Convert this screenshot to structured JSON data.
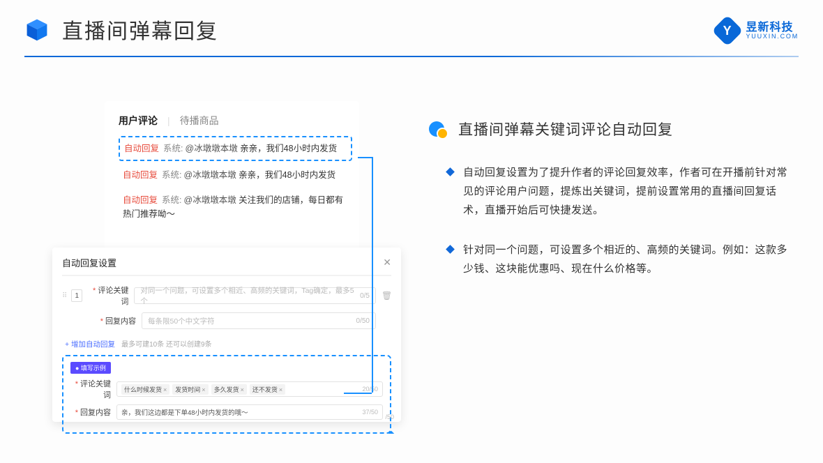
{
  "header": {
    "title": "直播间弹幕回复",
    "brandCn": "昱新科技",
    "brandEn": "YUUXIN.COM"
  },
  "right": {
    "title": "直播间弹幕关键词评论自动回复",
    "b1": "自动回复设置为了提升作者的评论回复效率，作者可在开播前针对常见的评论用户问题，提炼出关键词，提前设置常用的直播间回复话术，直播开始后可快捷发送。",
    "b2": "针对同一个问题，可设置多个相近的、高频的关键词。例如：这款多少钱、这块能优惠吗、现在什么价格等。"
  },
  "card1": {
    "tabA": "用户评论",
    "tabB": "待播商品",
    "r1": {
      "tag": "自动回复",
      "sys": "系统:",
      "at": "@冰墩墩本墩",
      "txt": " 亲亲，我们48小时内发货"
    },
    "r2": {
      "tag": "自动回复",
      "sys": "系统:",
      "at": "@冰墩墩本墩",
      "txt": " 亲亲，我们48小时内发货"
    },
    "r3": {
      "tag": "自动回复",
      "sys": "系统:",
      "at": "@冰墩墩本墩",
      "txt": " 关注我们的店铺，每日都有热门推荐呦～"
    }
  },
  "card2": {
    "title": "自动回复设置",
    "idx": "1",
    "lab1": "评论关键词",
    "ph1": "对同一个问题，可设置多个相近、高频的关键词，Tag确定，最多5个",
    "cnt1": "0/5",
    "lab2": "回复内容",
    "ph2": "每条限50个中文字符",
    "cnt2": "0/50",
    "add": "+ 增加自动回复",
    "hint": "最多可建10条 还可以创建9条",
    "exTag": "● 填写示例",
    "exLab1": "评论关键词",
    "tags": [
      "什么时候发货",
      "发货时间",
      "多久发货",
      "还不发货"
    ],
    "exCnt1": "20/50",
    "exLab2": "回复内容",
    "exVal2": "亲，我们这边都是下单48小时内发货的哦～",
    "exCnt2": "37/50",
    "outCnt": "/50"
  }
}
